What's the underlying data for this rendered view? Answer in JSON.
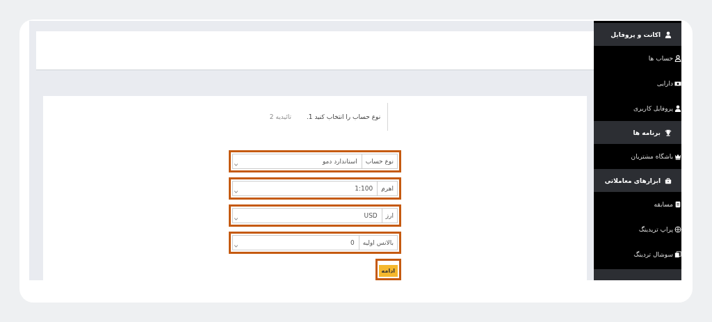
{
  "steps": [
    {
      "label": "نوع حساب را انتخاب کنید 1.",
      "selected": true
    },
    {
      "label": "تائیدیه 2",
      "selected": false
    }
  ],
  "form": {
    "fields": [
      {
        "label": "نوع حساب",
        "value": "استاندارد دمو",
        "highlighted": true
      },
      {
        "label": "اهرم",
        "value": "1:100",
        "highlighted": true
      },
      {
        "label": "ارز",
        "value": "USD",
        "highlighted": true
      },
      {
        "label": "بالانس اولیه",
        "value": "0",
        "highlighted": true
      }
    ],
    "submit": {
      "label": "ادامه",
      "highlighted": true
    }
  },
  "sidebar": {
    "sections": [
      {
        "title": "اکانت و پروفایل",
        "items": [
          {
            "label": "حساب ها"
          },
          {
            "label": "دارایی"
          },
          {
            "label": "پروفایل کاربری"
          }
        ]
      },
      {
        "title": "برنامه ها",
        "items": [
          {
            "label": "باشگاه مشتریان"
          }
        ]
      },
      {
        "title": "ابزارهای معاملاتی",
        "items": [
          {
            "label": "مسابقه"
          },
          {
            "label": "پراپ تریدینگ"
          },
          {
            "label": "سوشال تردینگ"
          }
        ]
      }
    ]
  }
}
